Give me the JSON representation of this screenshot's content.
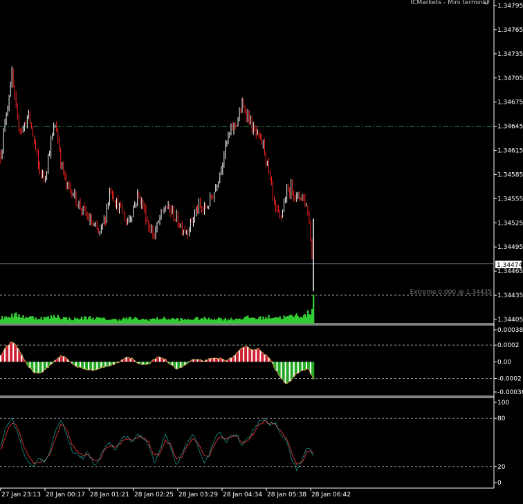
{
  "window": {
    "title": "ICMarkets - Mini terminal",
    "icon": "smiley-icon"
  },
  "colors": {
    "background": "#000000",
    "axis_text": "#ffffff",
    "bull_wick": "#ffffff",
    "bear_candle": "#ff2020",
    "volume": "#32cd32",
    "ma_line": "#2e8b57",
    "osc_pos": "#cc2233",
    "osc_neg": "#22aa22",
    "osc_line": "#c8a050",
    "stoch_main": "#20b2aa",
    "stoch_signal": "#cc3333",
    "current_line": "#708090",
    "level_line": "#a0a0a0"
  },
  "chart_data": [
    {
      "type": "candlestick",
      "panel": "price",
      "y_ticks": [
        "1.34795",
        "1.34765",
        "1.34735",
        "1.34705",
        "1.34675",
        "1.34645",
        "1.34615",
        "1.34585",
        "1.34555",
        "1.34525",
        "1.34495",
        "1.34465",
        "1.34435",
        "1.34405"
      ],
      "ylim": [
        1.34395,
        1.348
      ],
      "current_price": "1.34474",
      "level_line": 1.34645,
      "extreme_label": "Extreme 0.000 @ 1.34435",
      "extreme_price": 1.34435,
      "x_ticks": [
        "27 Jan 23:13",
        "28 Jan 00:17",
        "28 Jan 01:21",
        "28 Jan 02:25",
        "28 Jan 03:29",
        "28 Jan 04:34",
        "28 Jan 05:38",
        "28 Jan 06:42"
      ],
      "close_path": [
        1.3461,
        1.3466,
        1.3471,
        1.3465,
        1.3464,
        1.3466,
        1.3463,
        1.3459,
        1.3458,
        1.3462,
        1.3465,
        1.346,
        1.3457,
        1.34565,
        1.3455,
        1.3454,
        1.3453,
        1.3452,
        1.3451,
        1.3453,
        1.3457,
        1.3455,
        1.3454,
        1.34525,
        1.3454,
        1.3456,
        1.34545,
        1.3452,
        1.3451,
        1.3453,
        1.34545,
        1.3454,
        1.3453,
        1.3452,
        1.34515,
        1.3453,
        1.34545,
        1.3454,
        1.3455,
        1.34565,
        1.3459,
        1.3462,
        1.3464,
        1.3465,
        1.3467,
        1.3466,
        1.3464,
        1.3463,
        1.3462,
        1.3458,
        1.3454,
        1.3453,
        1.3456,
        1.3457,
        1.34555,
        1.3456,
        1.3454,
        1.3447
      ]
    },
    {
      "type": "bar",
      "panel": "volume",
      "ylim": [
        0,
        1
      ],
      "values_profile": [
        0.35,
        0.5,
        0.55,
        0.45,
        0.4,
        0.35,
        0.4,
        0.5,
        0.35,
        0.3,
        0.35,
        0.4,
        0.35,
        0.3,
        0.25,
        0.3,
        0.35,
        0.3,
        0.25,
        0.3,
        0.35,
        0.3,
        0.3,
        0.25,
        0.3,
        0.35,
        0.3,
        0.35,
        0.3,
        0.3,
        0.35,
        0.4,
        0.35,
        0.4,
        0.45,
        0.4,
        0.45,
        0.55,
        0.5,
        1.0
      ]
    },
    {
      "type": "histogram",
      "panel": "oscillator",
      "y_ticks": [
        "0.000383",
        "0.0002",
        "0.00",
        "-0.0002",
        "-0.00036"
      ],
      "ylim": [
        -0.00036,
        0.000383
      ],
      "levels": [
        0.0002,
        -0.0002
      ],
      "values": [
        8e-05,
        0.00018,
        0.00024,
        0.00018,
        6e-05,
        -5e-05,
        -0.00012,
        -0.00014,
        -0.0001,
        -4e-05,
        2e-05,
        8e-05,
        4e-05,
        -2e-05,
        -6e-05,
        -8e-05,
        -9e-05,
        -0.0001,
        -8e-05,
        -6e-05,
        -4e-05,
        -2e-05,
        2e-05,
        6e-05,
        4e-05,
        -2e-05,
        -4e-05,
        -3e-05,
        3e-05,
        6e-05,
        3e-05,
        -4e-05,
        -8e-05,
        -6e-05,
        -2e-05,
        3e-05,
        2e-05,
        1e-05,
        3e-05,
        4e-05,
        4e-05,
        2e-05,
        4e-05,
        0.0001,
        0.00016,
        0.00018,
        0.00014,
        0.00016,
        0.0001,
        4e-05,
        -8e-05,
        -0.00018,
        -0.00026,
        -0.00022,
        -0.00014,
        -0.0001,
        -8e-05,
        -0.0002
      ]
    },
    {
      "type": "line",
      "panel": "stochastic",
      "y_ticks": [
        "100",
        "80",
        "20",
        "0"
      ],
      "ylim": [
        0,
        100
      ],
      "levels": [
        80,
        20
      ],
      "main": [
        45,
        70,
        80,
        65,
        40,
        25,
        20,
        30,
        25,
        40,
        65,
        80,
        60,
        40,
        35,
        30,
        38,
        20,
        30,
        45,
        50,
        40,
        55,
        58,
        50,
        60,
        55,
        45,
        25,
        40,
        60,
        45,
        22,
        35,
        50,
        60,
        45,
        25,
        35,
        55,
        62,
        50,
        58,
        60,
        45,
        55,
        65,
        75,
        80,
        72,
        75,
        60,
        55,
        30,
        15,
        30,
        45,
        35
      ],
      "signal": [
        40,
        60,
        75,
        70,
        50,
        33,
        24,
        26,
        27,
        35,
        55,
        73,
        66,
        48,
        38,
        33,
        36,
        27,
        28,
        40,
        47,
        44,
        50,
        55,
        52,
        57,
        56,
        50,
        33,
        36,
        52,
        48,
        30,
        32,
        45,
        55,
        50,
        33,
        33,
        48,
        58,
        54,
        56,
        59,
        50,
        52,
        60,
        70,
        77,
        74,
        74,
        64,
        57,
        38,
        22,
        27,
        40,
        38
      ]
    }
  ]
}
